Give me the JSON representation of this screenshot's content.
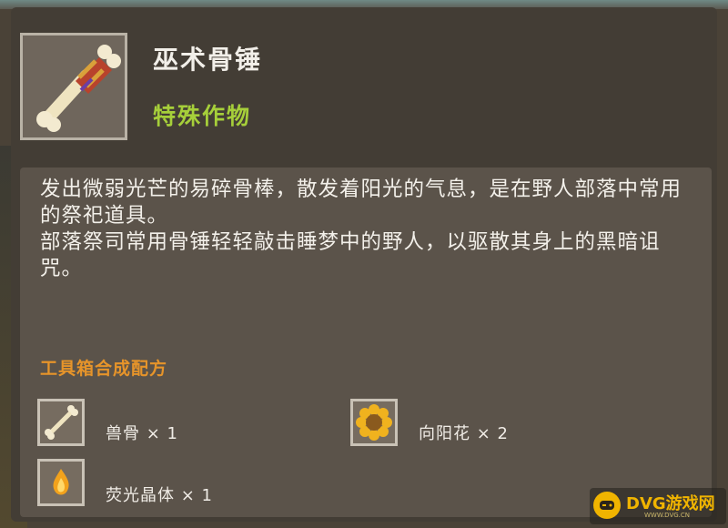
{
  "item": {
    "name": "巫术骨锤",
    "type": "特殊作物",
    "icon": "bone-hammer-icon"
  },
  "description": {
    "line1": "发出微弱光芒的易碎骨棒，散发着阳光的气息，是在野人部落中常用的祭祀道具。",
    "line2": "部落祭司常用骨锤轻轻敲击睡梦中的野人，以驱散其身上的黑暗诅咒。"
  },
  "recipe": {
    "title": "工具箱合成配方",
    "ingredients": [
      {
        "label": "兽骨 × 1",
        "icon": "bone-icon"
      },
      {
        "label": "向阳花 × 2",
        "icon": "sunflower-icon"
      },
      {
        "label": "荧光晶体 × 1",
        "icon": "glow-crystal-icon"
      }
    ]
  },
  "watermark": {
    "text": "DVG游戏网",
    "sub": "WWW.DVG.CN"
  },
  "colors": {
    "type_green": "#a6cf3a",
    "recipe_orange": "#e6942a",
    "watermark_yellow": "#f0b400"
  }
}
